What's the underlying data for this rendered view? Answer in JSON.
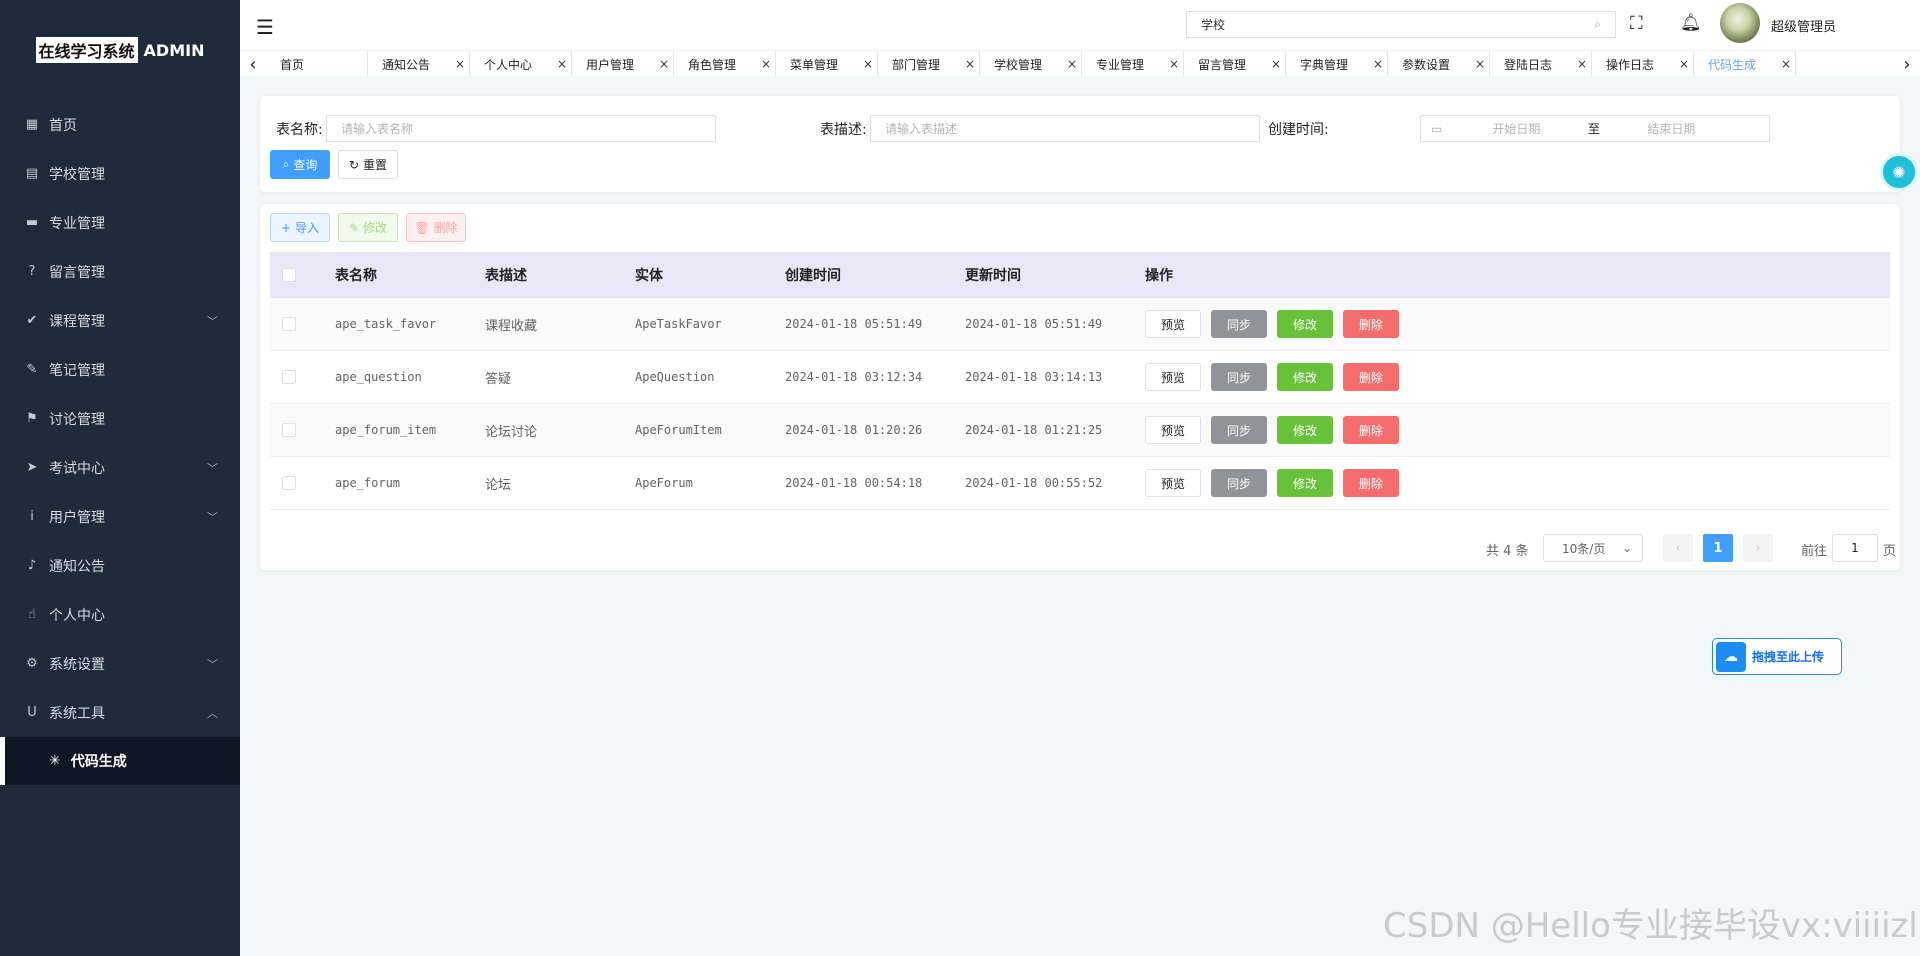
{
  "app": {
    "logo_highlight": "在线学习系统",
    "logo_suffix": "ADMIN",
    "search_value": "学校",
    "user_name": "超级管理员"
  },
  "sidebar": {
    "items": [
      {
        "label": "首页",
        "icon": "▦"
      },
      {
        "label": "学校管理",
        "icon": "▤"
      },
      {
        "label": "专业管理",
        "icon": "▬"
      },
      {
        "label": "留言管理",
        "icon": "?"
      },
      {
        "label": "课程管理",
        "icon": "✔",
        "arrow": "﹀"
      },
      {
        "label": "笔记管理",
        "icon": "✎"
      },
      {
        "label": "讨论管理",
        "icon": "⚑"
      },
      {
        "label": "考试中心",
        "icon": "➤",
        "arrow": "﹀"
      },
      {
        "label": "用户管理",
        "icon": "i",
        "arrow": "﹀"
      },
      {
        "label": "通知公告",
        "icon": "♪"
      },
      {
        "label": "个人中心",
        "icon": "☝"
      },
      {
        "label": "系统设置",
        "icon": "⚙",
        "arrow": "﹀"
      },
      {
        "label": "系统工具",
        "icon": "U",
        "arrow": "︿"
      }
    ],
    "active_sub": {
      "label": "代码生成",
      "icon": "✳"
    }
  },
  "tabs": [
    "首页",
    "通知公告",
    "个人中心",
    "用户管理",
    "角色管理",
    "菜单管理",
    "部门管理",
    "学校管理",
    "专业管理",
    "留言管理",
    "字典管理",
    "参数设置",
    "登陆日志",
    "操作日志",
    "代码生成"
  ],
  "active_tab": "代码生成",
  "filters": {
    "table_name_label": "表名称:",
    "table_name_placeholder": "请输入表名称",
    "table_desc_label": "表描述:",
    "table_desc_placeholder": "请输入表描述",
    "create_time_label": "创建时间:",
    "start_date_placeholder": "开始日期",
    "date_separator": "至",
    "end_date_placeholder": "结束日期",
    "query_label": "查询",
    "reset_label": "重置"
  },
  "toolbar": {
    "import_label": "导入",
    "modify_label": "修改",
    "delete_label": "删除"
  },
  "table": {
    "headers": [
      "表名称",
      "表描述",
      "实体",
      "创建时间",
      "更新时间",
      "操作"
    ],
    "rows": [
      {
        "name": "ape_task_favor",
        "desc": "课程收藏",
        "entity": "ApeTaskFavor",
        "created": "2024-01-18 05:51:49",
        "updated": "2024-01-18 05:51:49"
      },
      {
        "name": "ape_question",
        "desc": "答疑",
        "entity": "ApeQuestion",
        "created": "2024-01-18 03:12:34",
        "updated": "2024-01-18 03:14:13"
      },
      {
        "name": "ape_forum_item",
        "desc": "论坛讨论",
        "entity": "ApeForumItem",
        "created": "2024-01-18 01:20:26",
        "updated": "2024-01-18 01:21:25"
      },
      {
        "name": "ape_forum",
        "desc": "论坛",
        "entity": "ApeForum",
        "created": "2024-01-18 00:54:18",
        "updated": "2024-01-18 00:55:52"
      }
    ],
    "actions": {
      "preview": "预览",
      "sync": "同步",
      "modify": "修改",
      "delete": "删除"
    }
  },
  "pagination": {
    "total_text": "共 4 条",
    "page_size": "10条/页",
    "current_page": "1",
    "goto_label": "前往",
    "goto_value": "1",
    "page_suffix": "页"
  },
  "upload_widget": {
    "label": "拖拽至此上传"
  },
  "watermark": "CSDN @Hello专业接毕设vx:viiiizl"
}
